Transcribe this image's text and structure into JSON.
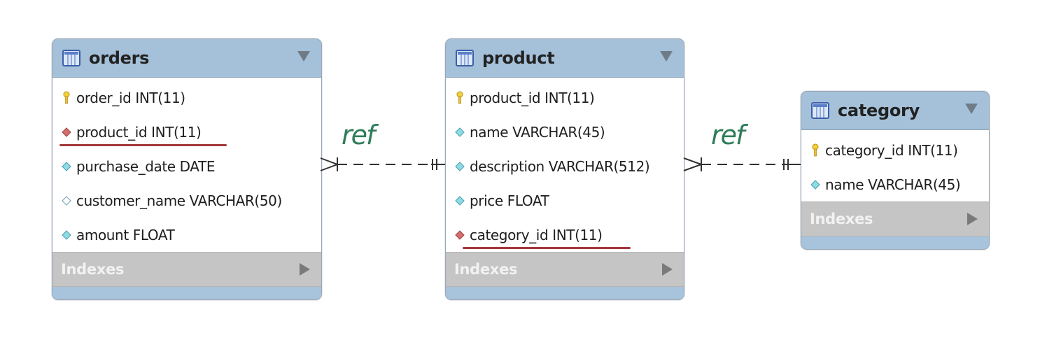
{
  "tables": {
    "orders": {
      "title": "orders",
      "columns": [
        {
          "label": "order_id INT(11)",
          "icon": "primary-key-icon"
        },
        {
          "label": "product_id INT(11)",
          "icon": "foreign-key-icon"
        },
        {
          "label": "purchase_date DATE",
          "icon": "column-filled-diamond-icon"
        },
        {
          "label": "customer_name VARCHAR(50)",
          "icon": "column-hollow-diamond-icon"
        },
        {
          "label": "amount FLOAT",
          "icon": "column-filled-diamond-icon"
        }
      ],
      "indexes_label": "Indexes"
    },
    "product": {
      "title": "product",
      "columns": [
        {
          "label": "product_id INT(11)",
          "icon": "primary-key-icon"
        },
        {
          "label": "name VARCHAR(45)",
          "icon": "column-filled-diamond-icon"
        },
        {
          "label": "description VARCHAR(512)",
          "icon": "column-filled-diamond-icon"
        },
        {
          "label": "price FLOAT",
          "icon": "column-filled-diamond-icon"
        },
        {
          "label": "category_id INT(11)",
          "icon": "foreign-key-icon"
        }
      ],
      "indexes_label": "Indexes"
    },
    "category": {
      "title": "category",
      "columns": [
        {
          "label": "category_id INT(11)",
          "icon": "primary-key-icon"
        },
        {
          "label": "name VARCHAR(45)",
          "icon": "column-filled-diamond-icon"
        }
      ],
      "indexes_label": "Indexes"
    }
  },
  "annotations": {
    "ref_left": "ref",
    "ref_right": "ref",
    "annotation_color": "#2e7d5a",
    "underline_color": "#a23a3a"
  }
}
